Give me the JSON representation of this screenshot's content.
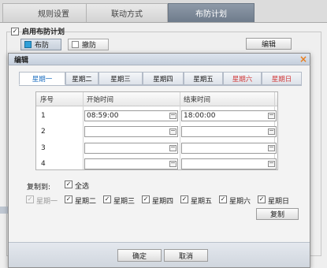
{
  "top_tabs": [
    "规则设置",
    "联动方式",
    "布防计划"
  ],
  "enable_plan": {
    "label": "启用布防计划",
    "checked": true,
    "check_glyph": "✓"
  },
  "mode_buttons": {
    "arm": "布防",
    "disarm": "撤防"
  },
  "edit_button": "编辑",
  "dialog": {
    "title": "编辑",
    "close_glyph": "×",
    "day_tabs": [
      "星期一",
      "星期二",
      "星期三",
      "星期四",
      "星期五",
      "星期六",
      "星期日"
    ],
    "active_day": 0,
    "table": {
      "headers": [
        "序号",
        "开始时间",
        "结束时间"
      ],
      "rows": [
        {
          "index": "1",
          "start": "08:59:00",
          "end": "18:00:00"
        },
        {
          "index": "2",
          "start": "",
          "end": ""
        },
        {
          "index": "3",
          "start": "",
          "end": ""
        },
        {
          "index": "4",
          "start": "",
          "end": ""
        }
      ]
    },
    "copy_to_label": "复制到:",
    "select_all": {
      "label": "全选",
      "checked": true
    },
    "copy_days": [
      {
        "label": "星期一",
        "checked": true,
        "disabled": true
      },
      {
        "label": "星期二",
        "checked": true,
        "disabled": false
      },
      {
        "label": "星期三",
        "checked": true,
        "disabled": false
      },
      {
        "label": "星期四",
        "checked": true,
        "disabled": false
      },
      {
        "label": "星期五",
        "checked": true,
        "disabled": false
      },
      {
        "label": "星期六",
        "checked": true,
        "disabled": false
      },
      {
        "label": "星期日",
        "checked": true,
        "disabled": false
      }
    ],
    "copy_button": "复制",
    "ok_button": "确定",
    "cancel_button": "取消"
  },
  "colors": {
    "active_tab_text": "#1f70c1",
    "weekend_text": "#d23a3a",
    "arm_swatch": "#2f9fd8",
    "close_icon": "#e87d1c"
  }
}
